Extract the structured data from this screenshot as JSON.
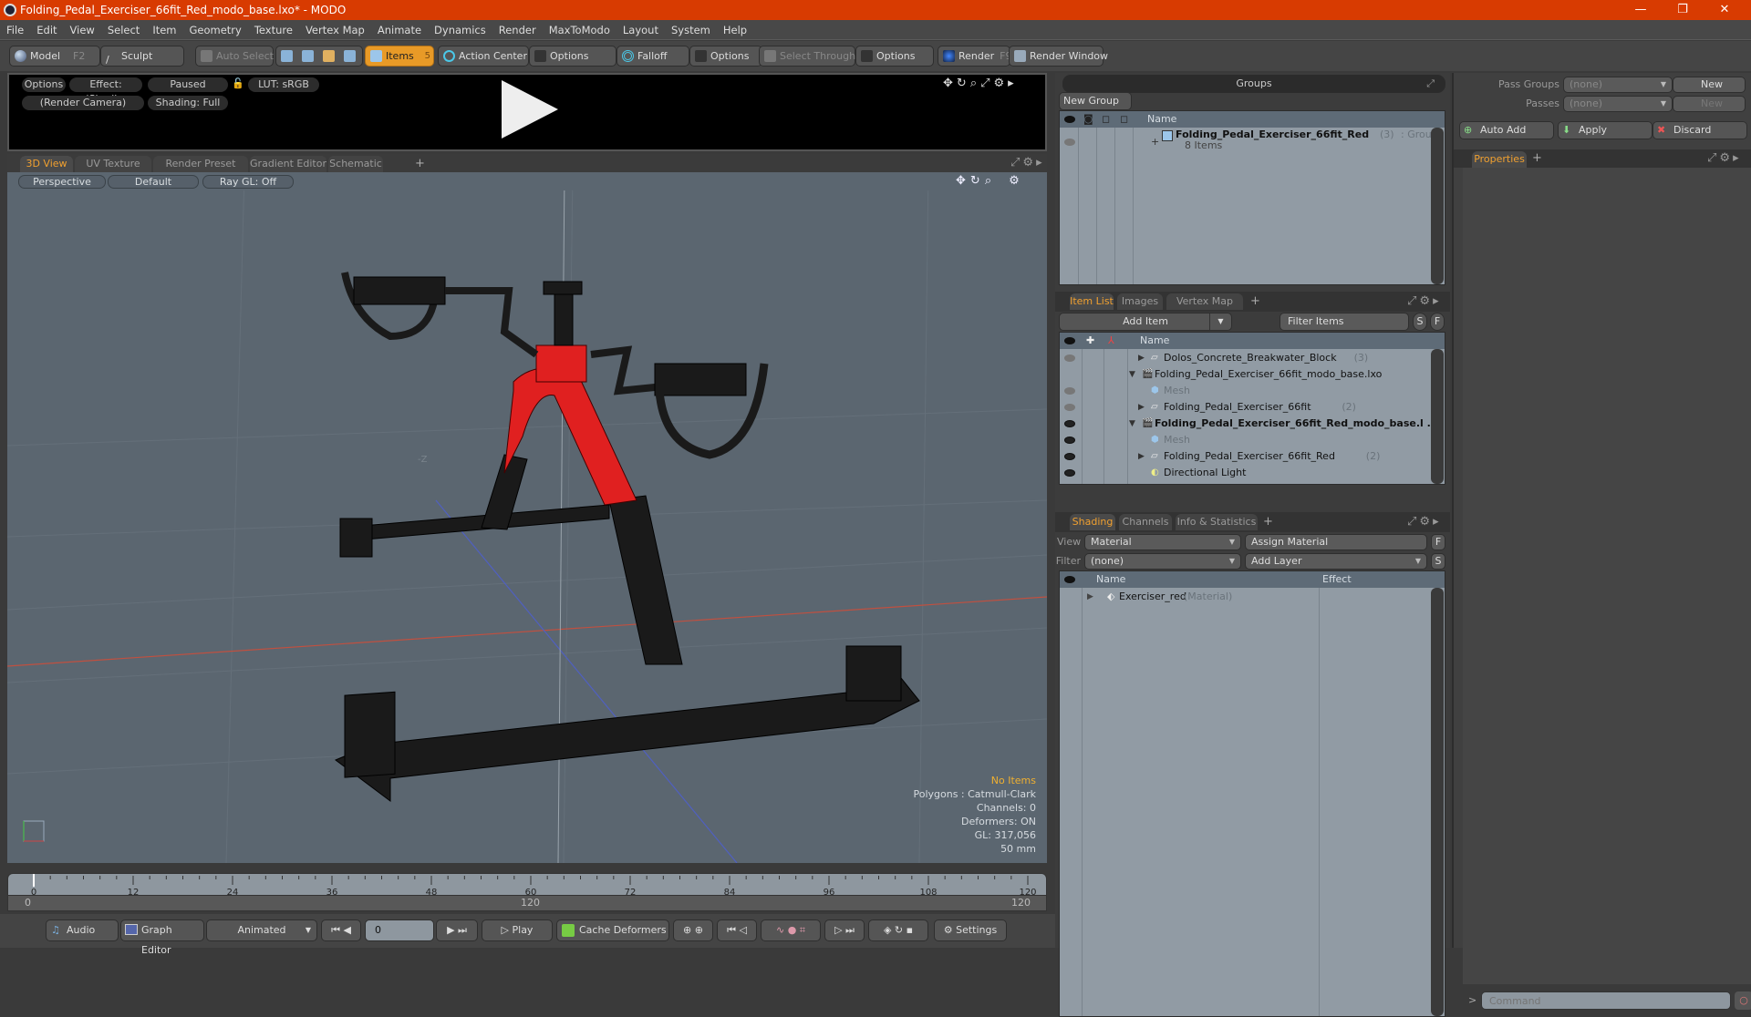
{
  "window": {
    "title": "Folding_Pedal_Exerciser_66fit_Red_modo_base.lxo* - MODO",
    "minimize": "—",
    "restore": "❐",
    "close": "✕"
  },
  "menu": [
    "File",
    "Edit",
    "View",
    "Select",
    "Item",
    "Geometry",
    "Texture",
    "Vertex Map",
    "Animate",
    "Dynamics",
    "Render",
    "MaxToModo",
    "Layout",
    "System",
    "Help"
  ],
  "toolbar": {
    "model": "Model",
    "model_key": "F2",
    "sculpt": "Sculpt",
    "auto_select": "Auto Select",
    "items": "Items",
    "items_key": "5",
    "action_center": "Action Center",
    "options1": "Options",
    "falloff": "Falloff",
    "options2": "Options",
    "select_through": "Select Through",
    "options3": "Options",
    "render": "Render",
    "render_key": "F9",
    "render_window": "Render Window"
  },
  "preview": {
    "options": "Options",
    "effect": "Effect: (Shadi...",
    "paused": "Paused",
    "lut": "LUT: sRGB",
    "camera": "(Render Camera)",
    "shading": "Shading: Full"
  },
  "viewport_tabs": [
    "3D View",
    "UV Texture View",
    "Render Preset Browser",
    "Gradient Editor",
    "Schematic",
    "+"
  ],
  "viewport": {
    "projection": "Perspective",
    "style": "Default",
    "raygl": "Ray GL: Off",
    "axis_label": "-Z",
    "stats": {
      "selection": "No Items",
      "polygons": "Polygons : Catmull-Clark",
      "channels": "Channels: 0",
      "deformers": "Deformers: ON",
      "gl": "GL: 317,056",
      "lens": "50 mm"
    }
  },
  "timeline": {
    "ticks": [
      "0",
      "12",
      "24",
      "36",
      "48",
      "60",
      "72",
      "84",
      "96",
      "108",
      "120"
    ],
    "range_start": "0",
    "range_mid": "120",
    "range_end": "120"
  },
  "transport": {
    "audio": "Audio",
    "graph_editor": "Graph Editor",
    "mode": "Animated",
    "frame": "0",
    "play": "Play",
    "cache": "Cache Deformers",
    "settings": "Settings"
  },
  "groups": {
    "title": "Groups",
    "new_group": "New Group",
    "col_name": "Name",
    "row": {
      "name": "Folding_Pedal_Exerciser_66fit_Red",
      "count": "(3)",
      "type": ": Group",
      "sub": "8 Items"
    }
  },
  "item_list": {
    "tabs": [
      "Item List",
      "Images",
      "Vertex Map List",
      "+"
    ],
    "add_item": "Add Item",
    "filter": "Filter Items",
    "s": "S",
    "f": "F",
    "col_name": "Name",
    "rows": [
      {
        "name": "Dolos_Concrete_Breakwater_Block",
        "count": "(3)"
      },
      {
        "name": "Folding_Pedal_Exerciser_66fit_modo_base.lxo",
        "count": ""
      },
      {
        "name": "Mesh",
        "count": ""
      },
      {
        "name": "Folding_Pedal_Exerciser_66fit",
        "count": "(2)"
      },
      {
        "name": "Folding_Pedal_Exerciser_66fit_Red_modo_base.l ...",
        "count": ""
      },
      {
        "name": "Mesh",
        "count": ""
      },
      {
        "name": "Folding_Pedal_Exerciser_66fit_Red",
        "count": "(2)"
      },
      {
        "name": "Directional Light",
        "count": ""
      }
    ]
  },
  "shading": {
    "tabs": [
      "Shading",
      "Channels",
      "Info & Statistics",
      "+"
    ],
    "view_label": "View",
    "view_value": "Material",
    "assign": "Assign Material",
    "f": "F",
    "filter_label": "Filter",
    "filter_value": "(none)",
    "add_layer": "Add Layer",
    "s": "S",
    "col_name": "Name",
    "col_effect": "Effect",
    "row": {
      "name": "Exerciser_red",
      "type": "(Material)"
    }
  },
  "passes": {
    "pass_groups_label": "Pass Groups",
    "pass_groups_value": "(none)",
    "new1": "New",
    "passes_label": "Passes",
    "passes_value": "(none)",
    "new2": "New",
    "auto_add": "Auto Add",
    "apply": "Apply",
    "discard": "Discard"
  },
  "properties": {
    "tab": "Properties",
    "plus": "+"
  },
  "command": {
    "prompt": ">",
    "placeholder": "Command"
  }
}
